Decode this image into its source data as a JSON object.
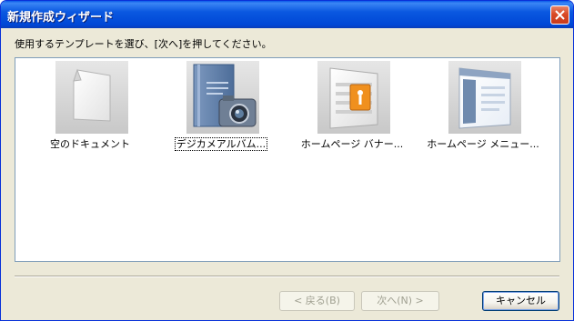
{
  "window": {
    "title": "新規作成ウィザード"
  },
  "instruction": "使用するテンプレートを選び、[次へ]を押してください。",
  "templates": [
    {
      "label": "空のドキュメント",
      "icon": "blank-document-icon"
    },
    {
      "label": "デジカメアルバム...",
      "icon": "camera-album-icon"
    },
    {
      "label": "ホームページ バナー...",
      "icon": "homepage-banner-icon"
    },
    {
      "label": "ホームページ メニュー...",
      "icon": "homepage-menu-icon"
    }
  ],
  "buttons": {
    "back": "< 戻る(B)",
    "next": "次へ(N) >",
    "cancel": "キャンセル"
  },
  "colors": {
    "titlebar": "#0054e3",
    "accent_orange": "#f0901e"
  }
}
